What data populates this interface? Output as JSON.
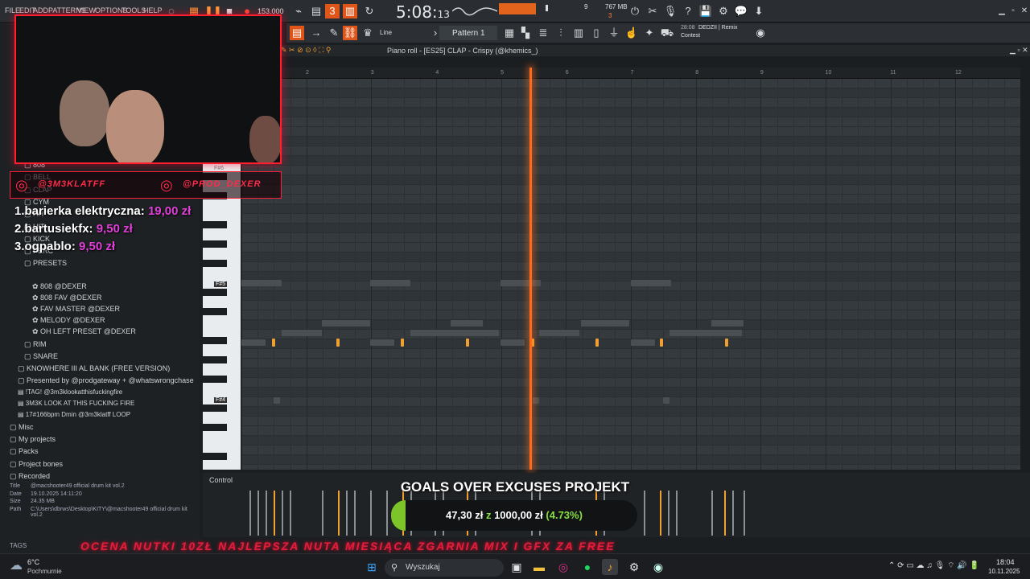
{
  "menu": [
    "FILE",
    "EDIT",
    "ADD",
    "PATTERNS",
    "VIEW",
    "OPTIONS",
    "TOOLS",
    "HELP"
  ],
  "transport": {
    "tempo": "153.000",
    "time_main": "5:08:",
    "time_sub": "13",
    "memory": "767 MB",
    "cpu_a": "9",
    "cpu_b": "3"
  },
  "toolbar": {
    "snap": "Line",
    "pattern": "Pattern 1",
    "hint_time": "28:08",
    "hint_title": "DEDZII | Remix",
    "hint_sub": "Contest"
  },
  "piano_roll": {
    "title": "Piano roll - [ES25] CLAP - Crispy (@khemics_)",
    "ruler": [
      "2",
      "3",
      "4",
      "5",
      "6",
      "7",
      "8",
      "9",
      "10",
      "11",
      "12"
    ],
    "key_labels": [
      "F#6",
      "F#5",
      "F#4"
    ]
  },
  "browser": {
    "folders_a": [
      "808",
      "BELL",
      "CLAP",
      "CYM",
      "HH",
      "HIT",
      "KICK",
      "PERC",
      "PRESETS"
    ],
    "presets": [
      "808 @DEXER",
      "808 FAV @DEXER",
      "FAV MASTER @DEXER",
      "MELODY @DEXER",
      "OH LEFT PRESET @DEXER"
    ],
    "folders_b": [
      "RIM",
      "SNARE"
    ],
    "packs": [
      "KNOWHERE III AL BANK (FREE VERSION)",
      "Presented by @prodgateway + @whatswrongchase"
    ],
    "files": [
      "!TAG! @3m3klookatthisfuckingfire",
      "3M3K LOOK AT THIS FUCKING FIRE",
      "17#166bpm Dmin @3m3klatff LOOP"
    ],
    "roots": [
      "Misc",
      "My projects",
      "Packs",
      "Project bones",
      "Recorded"
    ],
    "info_labels": [
      "Title",
      "Date",
      "Size",
      "Path"
    ],
    "info_values": [
      "@macshooter49 official drum kit vol.2",
      "19.10.2025 14:11:20",
      "24.35 MB",
      "C:\\Users\\dbrws\\Desktop\\KITY\\@macshooter49 official drum kit vol.2"
    ],
    "tags_label": "TAGS"
  },
  "overlay": {
    "social_a": "@3M3KLATFF",
    "social_b": "@PROD_DEXER",
    "donors": [
      {
        "rank_name": "1.barierka elektryczna:",
        "amount": "19,00 zł"
      },
      {
        "rank_name": "2.bartusiekfx:",
        "amount": "9,50 zł"
      },
      {
        "rank_name": "3.ogpablo:",
        "amount": "9,50 zł"
      }
    ],
    "goal_title": "GOALS OVER EXCUSES PROJEKT",
    "goal_current": "47,30 zł",
    "goal_sep": "z",
    "goal_target": "1000,00 zł",
    "goal_pct": "(4.73%)",
    "goal_fraction": 0.0473,
    "ticker": "OCENA NUTKI 10ZŁ   NAJLEPSZA NUTA MIESIĄCA ZGARNIA MIX I GFX ZA FREE"
  },
  "control": {
    "label": "Control"
  },
  "taskbar": {
    "weather_temp": "6°C",
    "weather_desc": "Pochmurnie",
    "search_placeholder": "Wyszukaj",
    "clock_time": "18:04",
    "clock_date": "10.11.2025"
  },
  "colors": {
    "accent": "#ff6a1a",
    "note": "#f0a030",
    "overlay_red": "#ff1f2e",
    "donor_amount": "#e03fd8",
    "goal_fill": "#7cc42a"
  }
}
